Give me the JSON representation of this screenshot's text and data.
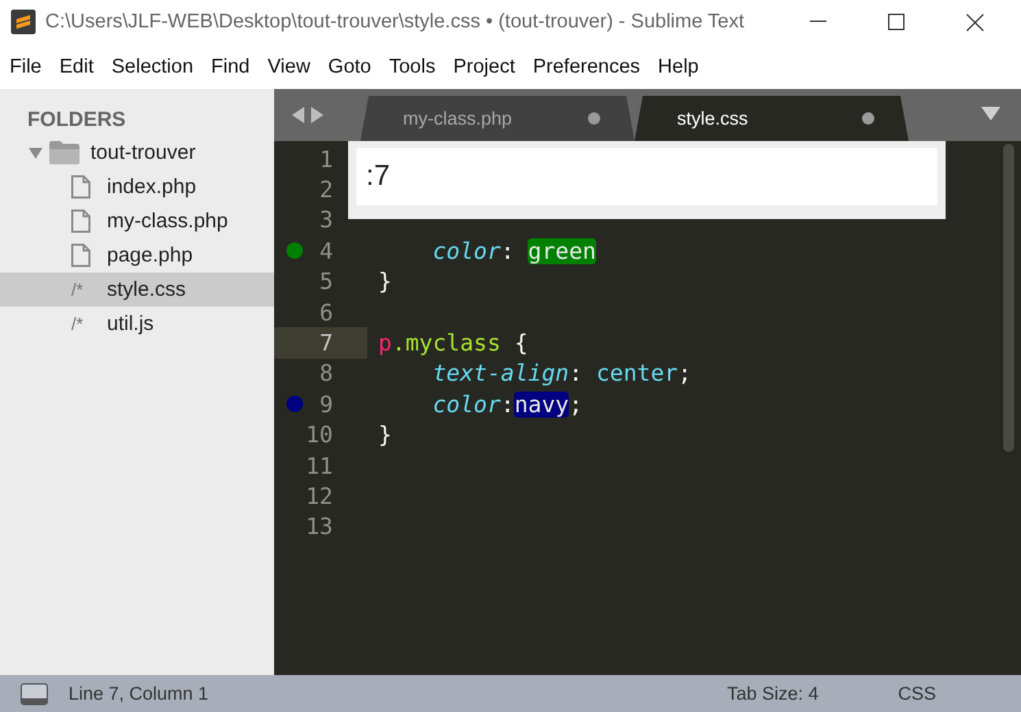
{
  "window": {
    "title": "C:\\Users\\JLF-WEB\\Desktop\\tout-trouver\\style.css • (tout-trouver) - Sublime Text"
  },
  "menu": [
    "File",
    "Edit",
    "Selection",
    "Find",
    "View",
    "Goto",
    "Tools",
    "Project",
    "Preferences",
    "Help"
  ],
  "sidebar": {
    "heading": "FOLDERS",
    "tree": [
      {
        "label": "tout-trouver",
        "kind": "folder",
        "expanded": true,
        "selected": false,
        "children": [
          {
            "label": "index.php",
            "kind": "file",
            "selected": false
          },
          {
            "label": "my-class.php",
            "kind": "file",
            "selected": false
          },
          {
            "label": "page.php",
            "kind": "file",
            "selected": false
          },
          {
            "label": "style.css",
            "kind": "code",
            "icon": "/*",
            "selected": true
          },
          {
            "label": "util.js",
            "kind": "code",
            "icon": "/*",
            "selected": false
          }
        ]
      }
    ]
  },
  "tabs": [
    {
      "label": "my-class.php",
      "selected": false,
      "modified": true
    },
    {
      "label": "style.css",
      "selected": true,
      "modified": true
    }
  ],
  "goto": {
    "value": ":7"
  },
  "editor": {
    "lines": [
      {
        "number": "1",
        "current": false
      },
      {
        "number": "2",
        "current": false
      },
      {
        "number": "3",
        "current": false
      },
      {
        "number": "4",
        "current": false,
        "color": "#008000",
        "tokens": [
          {
            "text": "    color",
            "kind": "property"
          },
          {
            "text": ": ",
            "kind": "punct"
          },
          {
            "text": "green",
            "kind": "swatch",
            "color": "#008000"
          }
        ]
      },
      {
        "number": "5",
        "current": false,
        "tokens": [
          {
            "text": "}",
            "kind": "punct"
          }
        ]
      },
      {
        "number": "6",
        "current": false
      },
      {
        "number": "7",
        "current": true,
        "tokens": [
          {
            "text": "p",
            "kind": "tag"
          },
          {
            "text": ".myclass",
            "kind": "class"
          },
          {
            "text": " {",
            "kind": "punct"
          }
        ]
      },
      {
        "number": "8",
        "current": false,
        "tokens": [
          {
            "text": "    text-align",
            "kind": "property"
          },
          {
            "text": ": ",
            "kind": "punct"
          },
          {
            "text": "center",
            "kind": "value"
          },
          {
            "text": ";",
            "kind": "punct"
          }
        ]
      },
      {
        "number": "9",
        "current": false,
        "color": "#000080",
        "tokens": [
          {
            "text": "    color",
            "kind": "property"
          },
          {
            "text": ":",
            "kind": "punct"
          },
          {
            "text": "navy",
            "kind": "swatch",
            "color": "#000080"
          },
          {
            "text": ";",
            "kind": "punct"
          }
        ]
      },
      {
        "number": "10",
        "current": false,
        "tokens": [
          {
            "text": "}",
            "kind": "punct"
          }
        ]
      },
      {
        "number": "11",
        "current": false
      },
      {
        "number": "12",
        "current": false
      },
      {
        "number": "13",
        "current": false
      }
    ]
  },
  "status_bar": {
    "position": "Line 7, Column 1",
    "tab_size": "Tab Size: 4",
    "syntax": "CSS"
  }
}
